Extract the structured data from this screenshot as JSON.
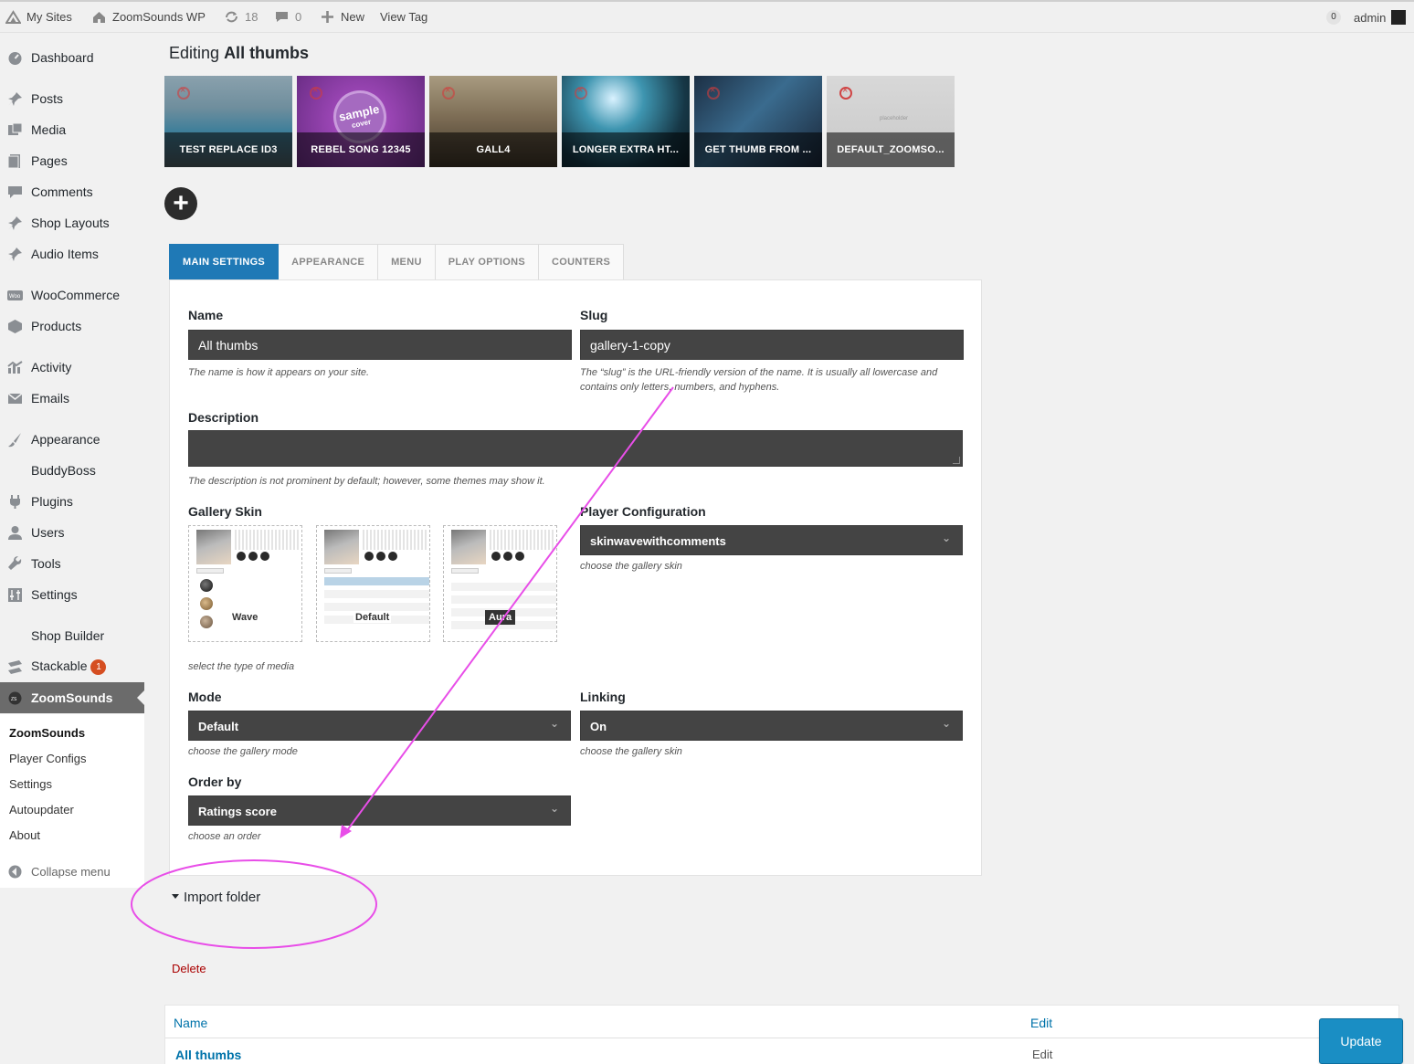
{
  "admin_bar": {
    "my_sites": "My Sites",
    "site_name": "ZoomSounds WP",
    "updates_count": "18",
    "comments_count": "0",
    "new_label": "New",
    "view_tag": "View Tag",
    "notifications_count": "0",
    "user_name": "admin"
  },
  "sidebar": {
    "items": [
      {
        "label": "Dashboard",
        "icon": "dashboard-icon"
      },
      {
        "label": "Posts",
        "icon": "pin-icon"
      },
      {
        "label": "Media",
        "icon": "media-icon"
      },
      {
        "label": "Pages",
        "icon": "pages-icon"
      },
      {
        "label": "Comments",
        "icon": "comment-icon"
      },
      {
        "label": "Shop Layouts",
        "icon": "pin-icon"
      },
      {
        "label": "Audio Items",
        "icon": "pin-icon"
      },
      {
        "label": "WooCommerce",
        "icon": "woocommerce-icon"
      },
      {
        "label": "Products",
        "icon": "box-icon"
      },
      {
        "label": "Activity",
        "icon": "activity-icon"
      },
      {
        "label": "Emails",
        "icon": "email-icon"
      },
      {
        "label": "Appearance",
        "icon": "brush-icon"
      },
      {
        "label": "BuddyBoss",
        "icon": "buddyboss-icon"
      },
      {
        "label": "Plugins",
        "icon": "plug-icon"
      },
      {
        "label": "Users",
        "icon": "user-icon"
      },
      {
        "label": "Tools",
        "icon": "wrench-icon"
      },
      {
        "label": "Settings",
        "icon": "sliders-icon"
      },
      {
        "label": "Shop Builder",
        "icon": ""
      },
      {
        "label": "Stackable",
        "icon": "stackable-icon",
        "badge": "1"
      },
      {
        "label": "ZoomSounds",
        "icon": "zoomsounds-icon"
      }
    ],
    "submenu": [
      "ZoomSounds",
      "Player Configs",
      "Settings",
      "Autoupdater",
      "About"
    ],
    "collapse": "Collapse menu"
  },
  "page": {
    "heading_prefix": "Editing",
    "heading_name": "All thumbs"
  },
  "thumbnails": [
    {
      "caption": "TEST REPLACE ID3",
      "color": "#5a7e8c"
    },
    {
      "caption": "REBEL SONG 12345",
      "color": "#8b3fa0"
    },
    {
      "caption": "GALL4",
      "color": "#6b5d48"
    },
    {
      "caption": "LONGER EXTRA HT...",
      "color": "#2f6f82"
    },
    {
      "caption": "GET THUMB FROM ...",
      "color": "#2b4a63"
    },
    {
      "caption": "DEFAULT_ZOOMSO...",
      "color": "#c9c9c9"
    }
  ],
  "thumb_extras": {
    "sample_text": "sample",
    "cover_text": "cover",
    "placeholder_text": "placeholder"
  },
  "tabs": [
    "MAIN SETTINGS",
    "APPEARANCE",
    "MENU",
    "PLAY OPTIONS",
    "COUNTERS"
  ],
  "form": {
    "name_label": "Name",
    "name_value": "All thumbs",
    "name_help": "The name is how it appears on your site.",
    "slug_label": "Slug",
    "slug_value": "gallery-1-copy",
    "slug_help": "The “slug” is the URL-friendly version of the name. It is usually all lowercase and contains only letters, numbers, and hyphens.",
    "description_label": "Description",
    "description_value": "",
    "description_help": "The description is not prominent by default; however, some themes may show it.",
    "gallery_skin_label": "Gallery Skin",
    "skins": [
      "Wave",
      "Default",
      "Aura"
    ],
    "gallery_skin_help": "select the type of media",
    "player_config_label": "Player Configuration",
    "player_config_value": "skinwavewithcomments",
    "player_config_help": "choose the gallery skin",
    "mode_label": "Mode",
    "mode_value": "Default",
    "mode_help": "choose the gallery mode",
    "linking_label": "Linking",
    "linking_value": "On",
    "linking_help": "choose the gallery skin",
    "order_label": "Order by",
    "order_value": "Ratings score",
    "order_help": "choose an order"
  },
  "import_folder": "Import folder",
  "delete_label": "Delete",
  "table": {
    "headers": [
      "Name",
      "Edit"
    ],
    "row_name": "All thumbs",
    "row_edit": "Edit"
  },
  "update_label": "Update",
  "annotation_color": "#e84ee8"
}
